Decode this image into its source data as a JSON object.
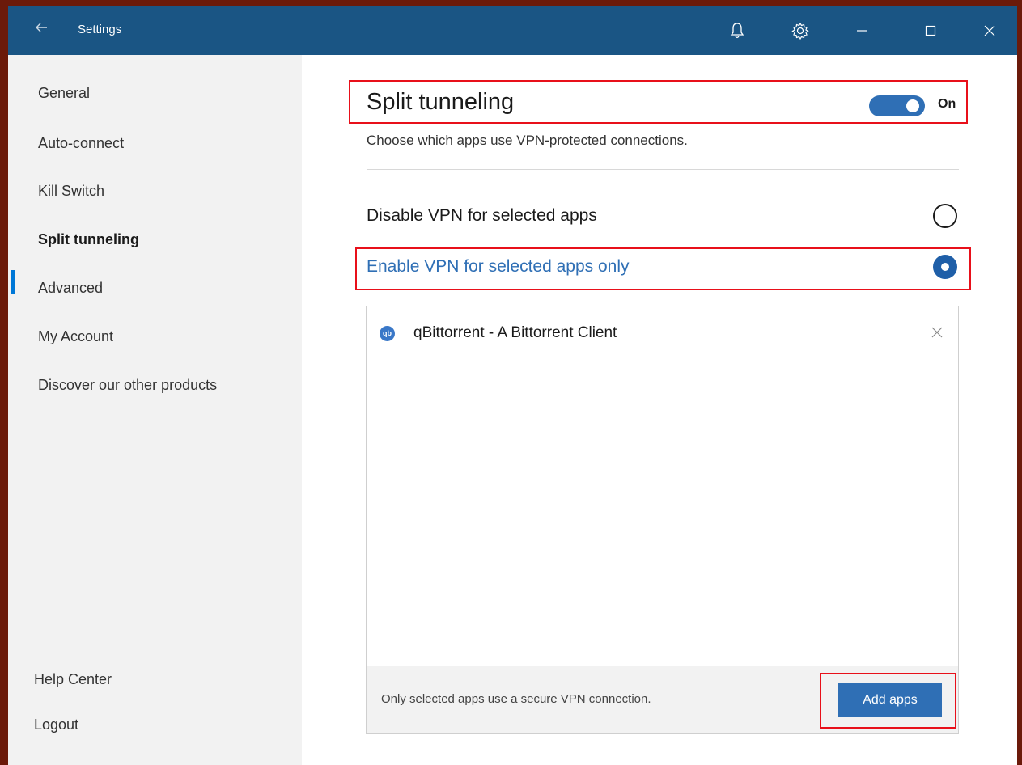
{
  "titlebar": {
    "back_icon": "arrow-left-icon",
    "title": "Settings",
    "icons": [
      "bell-icon",
      "gear-icon",
      "minimize-icon",
      "maximize-icon",
      "close-icon"
    ]
  },
  "sidebar": {
    "items": [
      {
        "label": "General"
      },
      {
        "label": "Auto-connect"
      },
      {
        "label": "Kill Switch"
      },
      {
        "label": "Split tunneling",
        "active": true
      },
      {
        "label": "Advanced"
      },
      {
        "label": "My Account"
      },
      {
        "label": "Discover our other products"
      }
    ],
    "bottom": [
      {
        "label": "Help Center"
      },
      {
        "label": "Logout"
      }
    ]
  },
  "main": {
    "title": "Split tunneling",
    "toggle": {
      "state": "On",
      "on": true
    },
    "subtitle": "Choose which apps use VPN-protected connections.",
    "options": [
      {
        "label": "Disable VPN for selected apps",
        "selected": false
      },
      {
        "label": "Enable VPN for selected apps only",
        "selected": true
      }
    ],
    "apps": [
      {
        "name": "qBittorrent - A Bittorrent Client",
        "icon_text": "qb"
      }
    ],
    "footer": {
      "text": "Only selected apps use a secure VPN connection.",
      "button": "Add apps"
    }
  },
  "colors": {
    "titlebar": "#1a5584",
    "accent": "#2f6fb5",
    "highlight": "#e8101a",
    "sidebar_bg": "#f2f2f2"
  }
}
